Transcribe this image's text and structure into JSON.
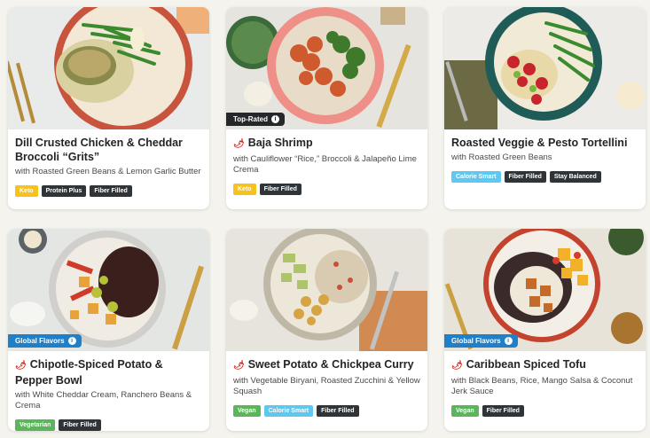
{
  "cards": [
    {
      "title": "Dill Crusted Chicken & Cheddar Broccoli “Grits”",
      "subtitle": "with Roasted Green Beans & Lemon Garlic Butter",
      "tags": [
        "Keto",
        "Protein Plus",
        "Fiber Filled"
      ]
    },
    {
      "badge": "Top-Rated",
      "title": "Baja Shrimp",
      "subtitle": "with Cauliflower “Rice,” Broccoli & Jalapeño Lime Crema",
      "tags": [
        "Keto",
        "Fiber Filled"
      ]
    },
    {
      "title": "Roasted Veggie & Pesto Tortellini",
      "subtitle": "with Roasted Green Beans",
      "tags": [
        "Calorie Smart",
        "Fiber Filled",
        "Stay Balanced"
      ]
    },
    {
      "badge": "Global Flavors",
      "title": "Chipotle-Spiced Potato & Pepper Bowl",
      "subtitle": "with White Cheddar Cream, Ranchero Beans & Crema",
      "tags": [
        "Vegetarian",
        "Fiber Filled"
      ]
    },
    {
      "title": "Sweet Potato & Chickpea Curry",
      "subtitle": "with Vegetable Biryani, Roasted Zucchini & Yellow Squash",
      "tags": [
        "Vegan",
        "Calorie Smart",
        "Fiber Filled"
      ]
    },
    {
      "badge": "Global Flavors",
      "title": "Caribbean Spiced Tofu",
      "subtitle": "with Black Beans, Rice, Mango Salsa & Coconut Jerk Sauce",
      "tags": [
        "Vegan",
        "Fiber Filled"
      ]
    }
  ],
  "icons": {
    "spicy": "chili-icon",
    "info": "info-icon"
  },
  "colors": {
    "keto": "#f6c21b",
    "dark_tag": "#2f3438",
    "calorie_smart": "#5ec8f0",
    "vegan": "#5bb55a",
    "top_rated": "#24282b",
    "global_flavors": "#1f7fc9",
    "spicy": "#c8261b"
  }
}
